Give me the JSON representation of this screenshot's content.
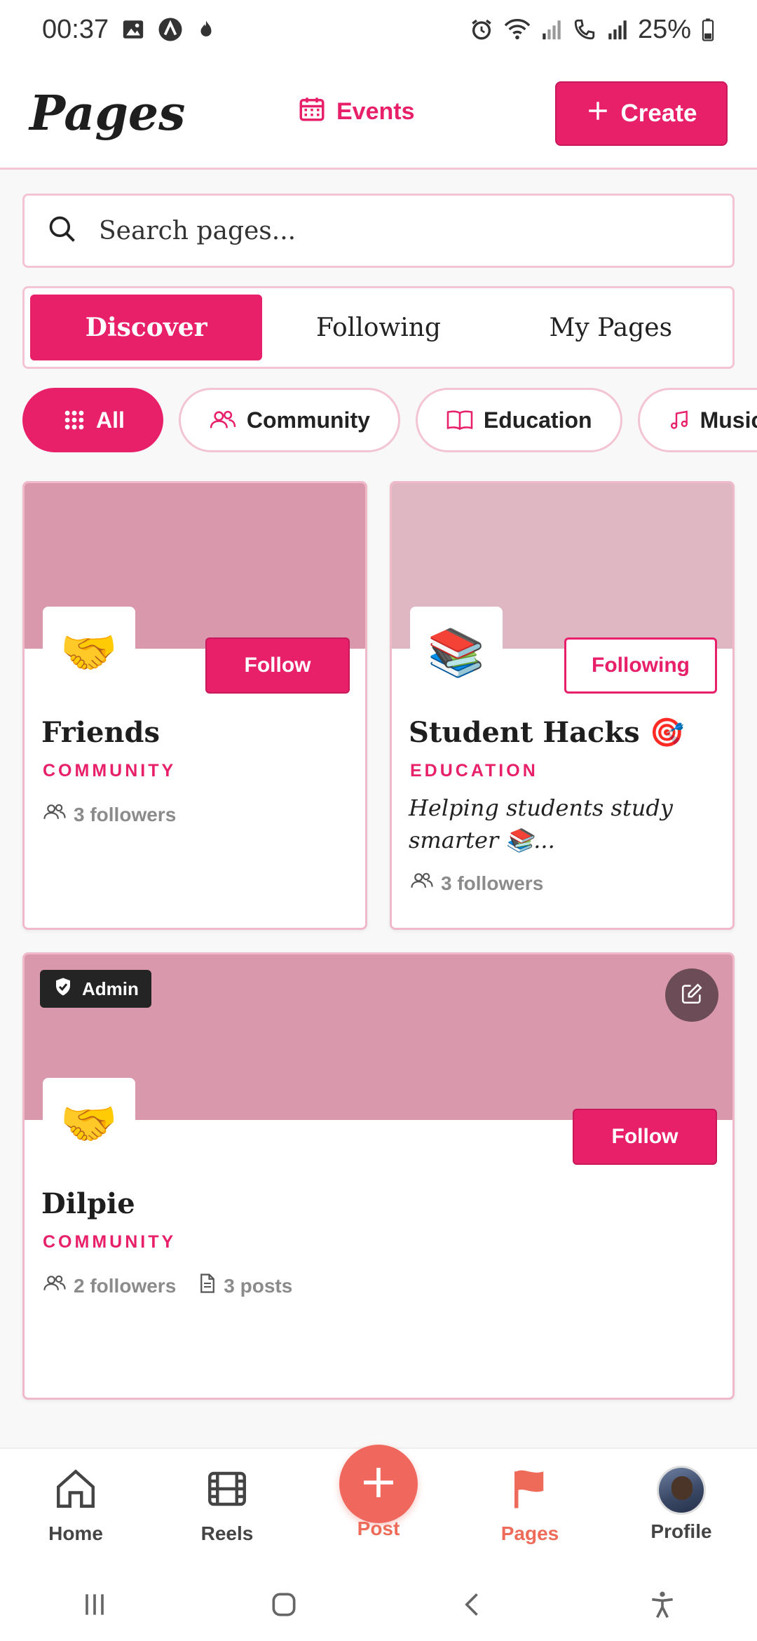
{
  "status_bar": {
    "time": "00:37",
    "battery": "25%"
  },
  "header": {
    "title": "Pages",
    "events_label": "Events",
    "create_label": "Create"
  },
  "search": {
    "placeholder": "Search pages..."
  },
  "tabs": [
    {
      "label": "Discover",
      "active": true
    },
    {
      "label": "Following",
      "active": false
    },
    {
      "label": "My Pages",
      "active": false
    }
  ],
  "categories": [
    {
      "label": "All",
      "icon": "grid-icon",
      "active": true
    },
    {
      "label": "Community",
      "icon": "users-icon",
      "active": false
    },
    {
      "label": "Education",
      "icon": "book-icon",
      "active": false
    },
    {
      "label": "Music",
      "icon": "music-icon",
      "active": false
    }
  ],
  "pages": [
    {
      "name": "Friends",
      "emoji": "🤝",
      "category": "COMMUNITY",
      "followers": "3 followers",
      "button": "Follow",
      "cover_color": "#d998ac"
    },
    {
      "name": "Student Hacks 🎯",
      "emoji": "📚",
      "category": "EDUCATION",
      "description": "Helping students study smarter 📚...",
      "followers": "3 followers",
      "button": "Following",
      "cover_color": "#dfb7c3"
    },
    {
      "name": "Dilpie",
      "emoji": "🤝",
      "category": "COMMUNITY",
      "followers": "2 followers",
      "posts": "3 posts",
      "button": "Follow",
      "badge": "Admin",
      "cover_color": "#d998ac"
    }
  ],
  "bottom_nav": [
    {
      "label": "Home",
      "icon": "home-icon"
    },
    {
      "label": "Reels",
      "icon": "film-icon"
    },
    {
      "label": "Post",
      "icon": "plus-icon"
    },
    {
      "label": "Pages",
      "icon": "flag-icon",
      "active": true
    },
    {
      "label": "Profile",
      "icon": "avatar"
    }
  ],
  "colors": {
    "accent": "#e8206a",
    "border": "#f3c4d2",
    "nav_active": "#ee6b59"
  }
}
